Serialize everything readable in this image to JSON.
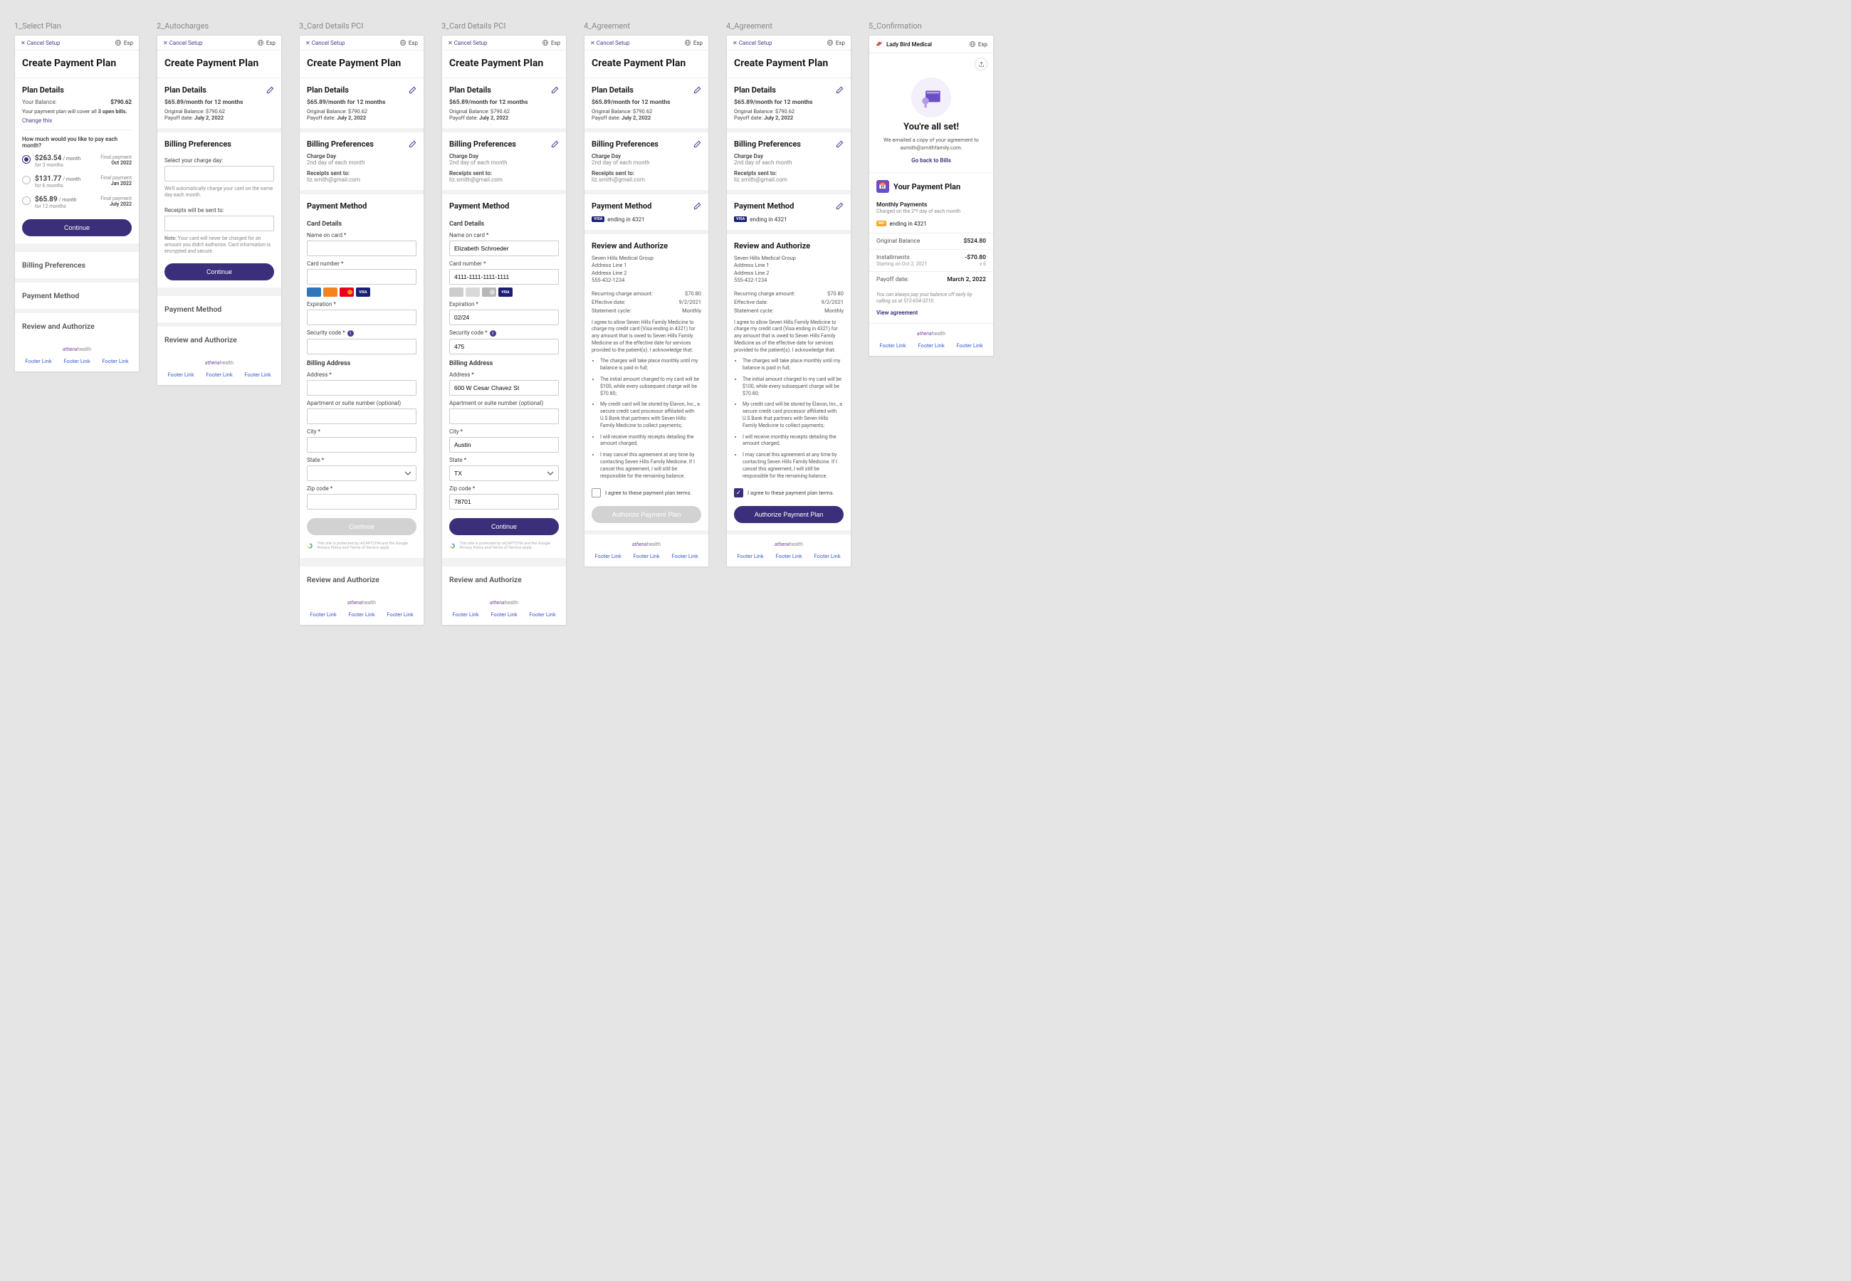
{
  "labels": {
    "col1": "1_Select Plan",
    "col2": "2_Autocharges",
    "col3a": "3_Card Details PCI",
    "col3b": "3_Card Details PCI",
    "col4a": "4_Agreement",
    "col4b": "4_Agreement",
    "col5": "5_Confirmation"
  },
  "common": {
    "cancel": "Cancel Setup",
    "lang": "Esp",
    "page_title": "Create Payment Plan",
    "plan_details": "Plan Details",
    "billing_prefs": "Billing Preferences",
    "payment_method": "Payment Method",
    "review": "Review and Authorize",
    "continue": "Continue",
    "brand1": "athena",
    "brand2": "health",
    "footer_link": "Footer Link"
  },
  "s1": {
    "balance_label": "Your Balance:",
    "balance_value": "$790.62",
    "desc_pre": "Your payment plan will cover all ",
    "desc_bold": "3 open bills.",
    "change": "Change this",
    "question": "How much would you like to pay each month?",
    "options": [
      {
        "amount": "$263.54",
        "per": "/ month",
        "dur": "for 3 months",
        "side_lbl": "Final payment",
        "side_dt": "Oct 2022"
      },
      {
        "amount": "$131.77",
        "per": "/ month",
        "dur": "for 6 months",
        "side_lbl": "Final payment",
        "side_dt": "Jan 2022"
      },
      {
        "amount": "$65.89",
        "per": "/ month",
        "dur": "for 12 months",
        "side_lbl": "Final payment",
        "side_dt": "July 2022"
      }
    ]
  },
  "plan_summary": {
    "line": "$65.89/month for 12 months",
    "orig_label": "Original Balance:",
    "orig_value": "$790.62",
    "payoff_label": "Payoff date:",
    "payoff_value": "July 2, 2022"
  },
  "s2": {
    "select_charge": "Select your charge day:",
    "auto_note": "We'll automatically charge your card on the same day each month.",
    "receipts_label": "Receipts will be sent to:",
    "pci_note_bold": "Note:",
    "pci_note": "Your card will never be charged for an amount you didn't authorize. Card information is encrypted and secure."
  },
  "bp": {
    "charge_day_label": "Charge Day",
    "charge_day_value": "2nd day of each month",
    "receipts_label": "Receipts sent to:",
    "receipts_value": "liz.smith@gmail.com"
  },
  "s3": {
    "card_details": "Card Details",
    "name_label": "Name on card *",
    "card_label": "Card number *",
    "exp_label": "Expiration *",
    "sec_label": "Security code *",
    "billing_addr": "Billing Address",
    "addr_label": "Address *",
    "apt_label": "Apartment or suite number (optional)",
    "city_label": "City *",
    "state_label": "State *",
    "zip_label": "Zip code *",
    "name_val": "Elizabeth Schroeder",
    "card_val": "4111-1111-1111-1111",
    "exp_val": "02/24",
    "sec_val": "475",
    "addr_val": "600 W Cesar Chavez St",
    "city_val": "Austin",
    "state_val": "TX",
    "zip_val": "78701",
    "recaptcha": "This site is protected by reCAPTCHA and the Google Privacy Policy and Terms of Service apply."
  },
  "pm": {
    "visa_ending": "ending in 4321"
  },
  "s4": {
    "org_name": "Seven Hills Medical Group",
    "org_l1": "Address Line 1",
    "org_l2": "Address Line 2",
    "org_ph": "555-432-1234",
    "charge_amt_lbl": "Recurring charge amount:",
    "charge_amt_val": "$70.80",
    "eff_lbl": "Effective date:",
    "eff_val": "9/2/2021",
    "cycle_lbl": "Statement cycle:",
    "cycle_val": "Monthly",
    "legal_intro": "I agree to allow Seven Hills Family Medicine to charge my credit card (Visa ending in 4321) for any amount that is owed to Seven Hills Family Medicine as of the effective date for services provided to the patient(s). I acknowledge that:",
    "bullets": [
      "The charges will take place monthly until my balance is paid in full;",
      "The initial amount charged to my card will be $100, while every subsequent charge will be $70.80;",
      "My credit card will be stored by Elavon, Inc., a secure credit card processor affiliated with U.S Bank that partners with Seven Hills Family Medicine to collect payments;",
      "I will receive monthly receipts detailing the amount charged;",
      "I may cancel this agreement at any time by contacting Seven Hills Family Medicine. If I cancel this agreement, I will still be responsible for the remaining balance."
    ],
    "agree_label": "I agree to these payment plan terms.",
    "authorize_btn": "Authorize Payment Plan"
  },
  "s5": {
    "org": "Lady Bird Medical",
    "title": "You're all set!",
    "msg_pre": "We emailed a copy of your agreement to ",
    "msg_email": "asmith@smithfamily.com.",
    "back": "Go back to Bills",
    "your_plan": "Your Payment Plan",
    "monthly_lbl": "Monthly Payments",
    "monthly_sub": "Charged on the 2ⁿᵈ day of each month",
    "cc_ending": "ending in 4321",
    "orig_lbl": "Original Balance",
    "orig_val": "$524.80",
    "inst_lbl": "Installments",
    "inst_sub": "Starting on Oct 2, 2021",
    "inst_val": "-$70.80",
    "inst_count": "x 6",
    "payoff_lbl": "Payoff date:",
    "payoff_val": "March 2, 2022",
    "help": "You can always pay your balance off early by calling us at 512-654-3210.",
    "view": "View agreement"
  }
}
